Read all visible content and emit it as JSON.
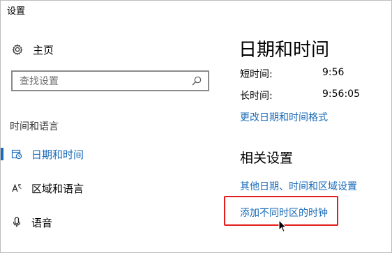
{
  "window": {
    "title": "设置"
  },
  "sidebar": {
    "home": {
      "label": "主页",
      "icon": "gear-icon"
    },
    "search": {
      "placeholder": "查找设置",
      "icon": "search-icon"
    },
    "section_header": "时间和语言",
    "items": [
      {
        "label": "日期和时间",
        "icon": "calendar-clock-icon",
        "active": true
      },
      {
        "label": "区域和语言",
        "icon": "language-region-icon",
        "active": false
      },
      {
        "label": "语音",
        "icon": "microphone-icon",
        "active": false
      }
    ]
  },
  "main": {
    "title": "日期和时间",
    "short_time": {
      "label": "短时间:",
      "value": "9:56"
    },
    "long_time": {
      "label": "长时间:",
      "value": "9:56:05"
    },
    "change_format_link": "更改日期和时间格式",
    "related": {
      "heading": "相关设置",
      "links": [
        "其他日期、时间和区域设置",
        "添加不同时区的时钟"
      ]
    }
  },
  "colors": {
    "accent": "#1a6bb8",
    "highlight": "#e31c1c",
    "border": "#bdbdbd"
  }
}
